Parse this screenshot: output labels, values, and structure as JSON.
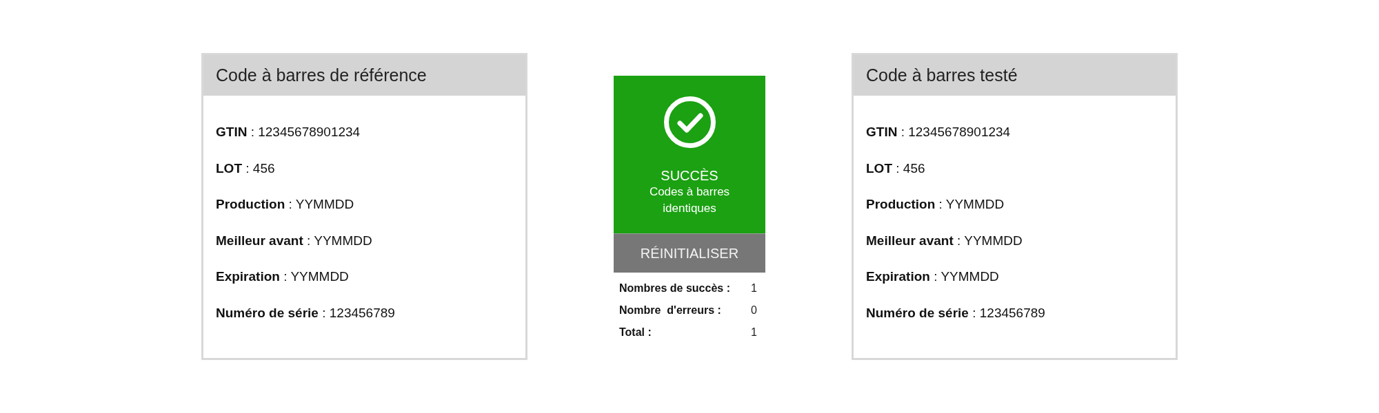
{
  "reference_card": {
    "title": "Code à barres de référence",
    "fields": [
      "**GTIN** : 12345678901234",
      "**LOT** : 456",
      "**Production** : YYMMDD",
      "**Meilleur avant** : YYMMDD",
      "**Expiration** : YYMMDD",
      "**Numéro de série** : 123456789"
    ]
  },
  "result": {
    "kind": "success",
    "title": "SUCCÈS",
    "message": "Codes à barres identiques",
    "reset_button": "RÉINITIALISER",
    "stats": [
      {
        "label": "Nombres de succès :",
        "value": "1"
      },
      {
        "label": "Nombre  d'erreurs :",
        "value": "0"
      },
      {
        "label": "Total :",
        "value": "1"
      }
    ]
  },
  "tested_card": {
    "title": "Code à barres testé",
    "fields": [
      "**GTIN** : 12345678901234",
      "**LOT** : 456",
      "**Production** : YYMMDD",
      "**Meilleur avant** : YYMMDD",
      "**Expiration** : YYMMDD",
      "**Numéro de série** : 123456789"
    ]
  }
}
